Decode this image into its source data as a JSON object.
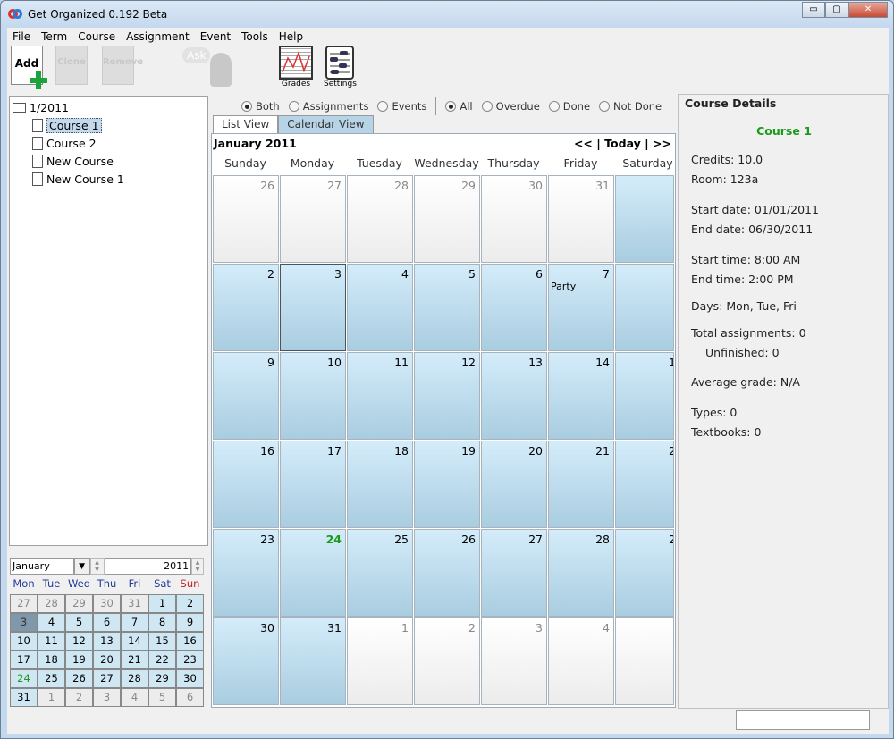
{
  "window": {
    "title": "Get Organized 0.192 Beta",
    "minimize": "▭",
    "maximize": "▢",
    "close": "✕"
  },
  "menu": [
    "File",
    "Term",
    "Course",
    "Assignment",
    "Event",
    "Tools",
    "Help"
  ],
  "toolbar": {
    "add": "Add",
    "clone": "Clone",
    "remove": "Remove",
    "ask": "Ask",
    "grades": "Grades",
    "settings": "Settings"
  },
  "tree": {
    "root": "1/2011",
    "items": [
      "Course 1",
      "Course 2",
      "New Course",
      "New Course 1"
    ],
    "selected": "Course 1"
  },
  "mini_calendar": {
    "month": "January",
    "year": "2011",
    "headers": [
      "Mon",
      "Tue",
      "Wed",
      "Thu",
      "Fri",
      "Sat",
      "Sun"
    ],
    "days": [
      "27",
      "28",
      "29",
      "30",
      "31",
      "1",
      "2",
      "3",
      "4",
      "5",
      "6",
      "7",
      "8",
      "9",
      "10",
      "11",
      "12",
      "13",
      "14",
      "15",
      "16",
      "17",
      "18",
      "19",
      "20",
      "21",
      "22",
      "23",
      "24",
      "25",
      "26",
      "27",
      "28",
      "29",
      "30",
      "31",
      "1",
      "2",
      "3",
      "4",
      "5",
      "6"
    ],
    "selected": "3",
    "today": "24"
  },
  "filters": {
    "type": [
      {
        "label": "Both",
        "checked": true
      },
      {
        "label": "Assignments",
        "checked": false
      },
      {
        "label": "Events",
        "checked": false
      }
    ],
    "status": [
      {
        "label": "All",
        "checked": true
      },
      {
        "label": "Overdue",
        "checked": false
      },
      {
        "label": "Done",
        "checked": false
      },
      {
        "label": "Not Done",
        "checked": false
      }
    ]
  },
  "tabs": [
    {
      "label": "List View",
      "active": false
    },
    {
      "label": "Calendar View",
      "active": true
    }
  ],
  "calendar": {
    "title": "January  2011",
    "nav": "<< | Today | >>",
    "weekdays": [
      "Sunday",
      "Monday",
      "Tuesday",
      "Wednesday",
      "Thursday",
      "Friday",
      "Saturday"
    ],
    "cells": [
      "26",
      "27",
      "28",
      "29",
      "30",
      "31",
      "",
      "2",
      "3",
      "4",
      "5",
      "6",
      "7",
      "",
      "9",
      "10",
      "11",
      "12",
      "13",
      "14",
      "1",
      "16",
      "17",
      "18",
      "19",
      "20",
      "21",
      "2",
      "23",
      "24",
      "25",
      "26",
      "27",
      "28",
      "2",
      "30",
      "31",
      "1",
      "2",
      "3",
      "4",
      ""
    ],
    "other_month_indices": [
      0,
      1,
      2,
      3,
      4,
      5,
      37,
      38,
      39,
      40,
      41
    ],
    "selected_index": 8,
    "today_index": 29,
    "events": [
      {
        "index": 12,
        "label": "Party"
      }
    ]
  },
  "details": {
    "heading": "Course Details",
    "name": "Course 1",
    "accent": "#1a9a1a",
    "lines": [
      "Credits: 10.0",
      "Room: 123a",
      "Start date: 01/01/2011",
      "End date: 06/30/2011",
      "Start time: 8:00 AM",
      "End time: 2:00 PM",
      "Days: Mon, Tue, Fri",
      "Total assignments: 0",
      "Unfinished: 0",
      "Average grade: N/A",
      "Types: 0",
      "Textbooks: 0"
    ]
  }
}
